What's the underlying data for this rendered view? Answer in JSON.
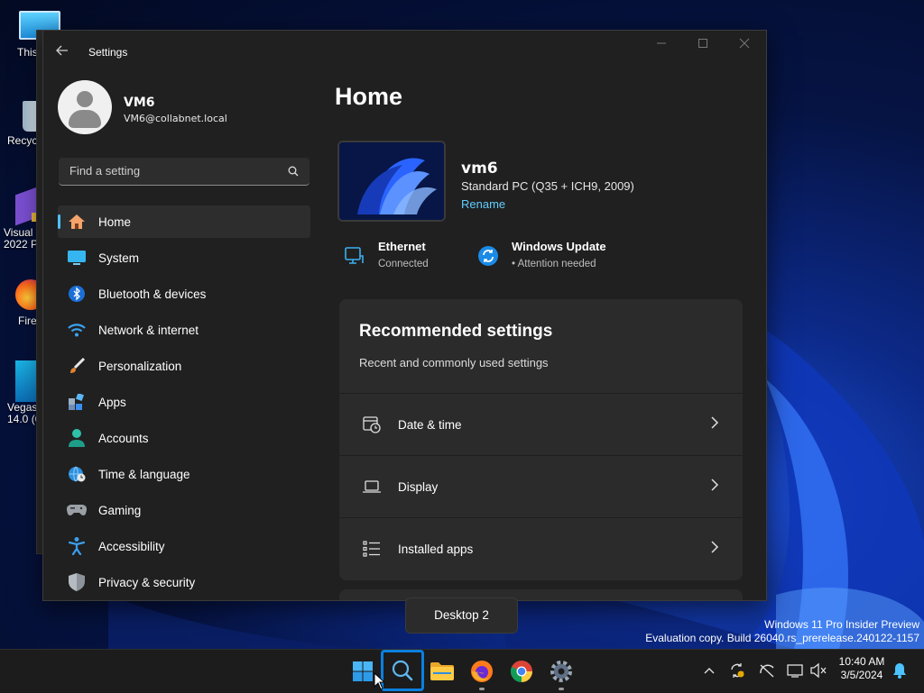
{
  "desktop": {
    "icons": [
      {
        "name": "desktop-icon-this-pc",
        "label": "This"
      },
      {
        "name": "desktop-icon-recycle-bin",
        "label": "Recyc"
      },
      {
        "name": "desktop-icon-visual-studio",
        "label": "Visual\n2022 P"
      },
      {
        "name": "desktop-icon-firefox",
        "label": "Fire"
      },
      {
        "name": "desktop-icon-vegas",
        "label": "Vegas\n14.0 (6"
      }
    ],
    "virtual_desktop_label": "Desktop 2",
    "watermark": {
      "line1": "Windows 11 Pro Insider Preview",
      "line2": "Evaluation copy. Build 26040.rs_prerelease.240122-1157"
    }
  },
  "window": {
    "title": "Settings",
    "controls": [
      "minimize",
      "maximize",
      "close"
    ]
  },
  "user": {
    "name": "VM6",
    "email": "VM6@collabnet.local"
  },
  "search": {
    "placeholder": "Find a setting"
  },
  "nav": {
    "items": [
      {
        "label": "Home",
        "icon": "home-icon",
        "active": true
      },
      {
        "label": "System",
        "icon": "system-monitor-icon"
      },
      {
        "label": "Bluetooth & devices",
        "icon": "bluetooth-icon"
      },
      {
        "label": "Network & internet",
        "icon": "wifi-icon"
      },
      {
        "label": "Personalization",
        "icon": "paintbrush-icon"
      },
      {
        "label": "Apps",
        "icon": "apps-icon"
      },
      {
        "label": "Accounts",
        "icon": "accounts-icon"
      },
      {
        "label": "Time & language",
        "icon": "globe-clock-icon"
      },
      {
        "label": "Gaming",
        "icon": "gamepad-icon"
      },
      {
        "label": "Accessibility",
        "icon": "accessibility-icon"
      },
      {
        "label": "Privacy & security",
        "icon": "shield-icon"
      }
    ]
  },
  "home": {
    "title": "Home",
    "pc": {
      "name": "vm6",
      "model": "Standard PC (Q35 + ICH9, 2009)",
      "rename_label": "Rename"
    },
    "status": [
      {
        "title": "Ethernet",
        "subtitle": "Connected",
        "icon": "ethernet-icon"
      },
      {
        "title": "Windows Update",
        "subtitle": "• Attention needed",
        "icon": "windows-update-icon"
      }
    ],
    "recommended": {
      "title": "Recommended settings",
      "subtitle": "Recent and commonly used settings",
      "items": [
        {
          "label": "Date & time",
          "icon": "date-time-icon"
        },
        {
          "label": "Display",
          "icon": "display-laptop-icon"
        },
        {
          "label": "Installed apps",
          "icon": "installed-apps-icon"
        }
      ]
    }
  },
  "taskbar": {
    "apps": [
      {
        "name": "start-button",
        "icon": "windows-logo-icon"
      },
      {
        "name": "search-button",
        "icon": "search-icon"
      },
      {
        "name": "file-explorer-button",
        "icon": "folder-icon"
      },
      {
        "name": "firefox-button",
        "icon": "firefox-icon"
      },
      {
        "name": "chrome-button",
        "icon": "chrome-icon"
      },
      {
        "name": "settings-button",
        "icon": "gear-icon"
      }
    ],
    "tray_icons": [
      "chevron-up-icon",
      "sync-icon",
      "network-disconnected-icon",
      "display-icon",
      "volume-muted-icon",
      "notification-bell-icon"
    ],
    "clock": {
      "time": "10:40 AM",
      "date": "3/5/2024"
    }
  },
  "colors": {
    "accent": "#4cc2ff",
    "link": "#60cdff",
    "window_bg": "#202020",
    "card_bg": "#2b2b2b",
    "taskbar_bg": "#1c1c1c"
  }
}
